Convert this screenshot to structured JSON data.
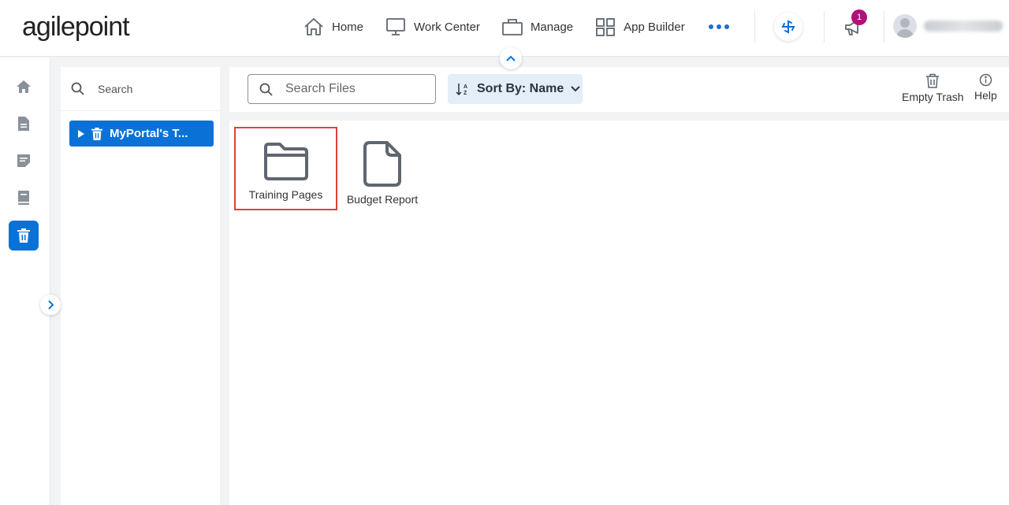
{
  "header": {
    "logo_text": "agilepoint",
    "nav": [
      {
        "label": "Home",
        "icon": "home-icon"
      },
      {
        "label": "Work Center",
        "icon": "monitor-icon"
      },
      {
        "label": "Manage",
        "icon": "briefcase-icon"
      },
      {
        "label": "App Builder",
        "icon": "grid-icon"
      }
    ],
    "more_icon": "more-dots-icon",
    "notification_count": "1"
  },
  "rail": {
    "items": [
      "home-icon",
      "document-icon",
      "form-icon",
      "book-icon",
      "trash-icon"
    ],
    "active_index": 4
  },
  "tree": {
    "search_label": "Search",
    "node_label": "MyPortal's T..."
  },
  "toolbar": {
    "search_placeholder": "Search Files",
    "sort_label": "Sort By: Name",
    "empty_trash_label": "Empty Trash",
    "help_label": "Help"
  },
  "files": [
    {
      "name": "Training Pages",
      "type": "folder",
      "selected": true
    },
    {
      "name": "Budget Report",
      "type": "file",
      "selected": false
    }
  ],
  "colors": {
    "accent": "#0a72d6",
    "badge": "#b0127a",
    "selection": "#e0413b",
    "icon_gray": "#5f6670"
  }
}
